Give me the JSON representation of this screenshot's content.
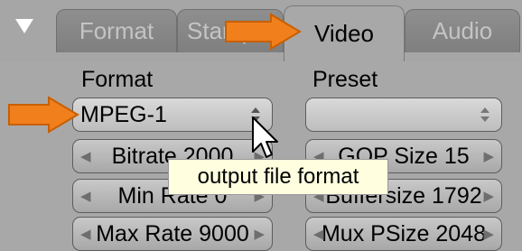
{
  "tabs": [
    {
      "label": "Format",
      "active": false
    },
    {
      "label": "Stamp",
      "active": false
    },
    {
      "label": "Video",
      "active": true
    },
    {
      "label": "Audio",
      "active": false
    }
  ],
  "format": {
    "heading": "Format",
    "value": "MPEG-1"
  },
  "preset": {
    "heading": "Preset",
    "value": ""
  },
  "controls": {
    "bitrate": "Bitrate 2000",
    "gop_size": "GOP Size 15",
    "min_rate": "Min Rate 0",
    "buffersize": "Buffersize 1792",
    "max_rate": "Max Rate 9000",
    "mux_psize": "Mux PSize 2048"
  },
  "tooltip": "output file format",
  "colors": {
    "accent_arrow": "#f07f1c",
    "tooltip_bg": "#ffffe0",
    "panel_bg": "#a8a8a8"
  },
  "icons": {
    "collapse": "triangle-down-icon",
    "pointer": "mouse-pointer-icon",
    "callout": "orange-arrow-icon"
  }
}
